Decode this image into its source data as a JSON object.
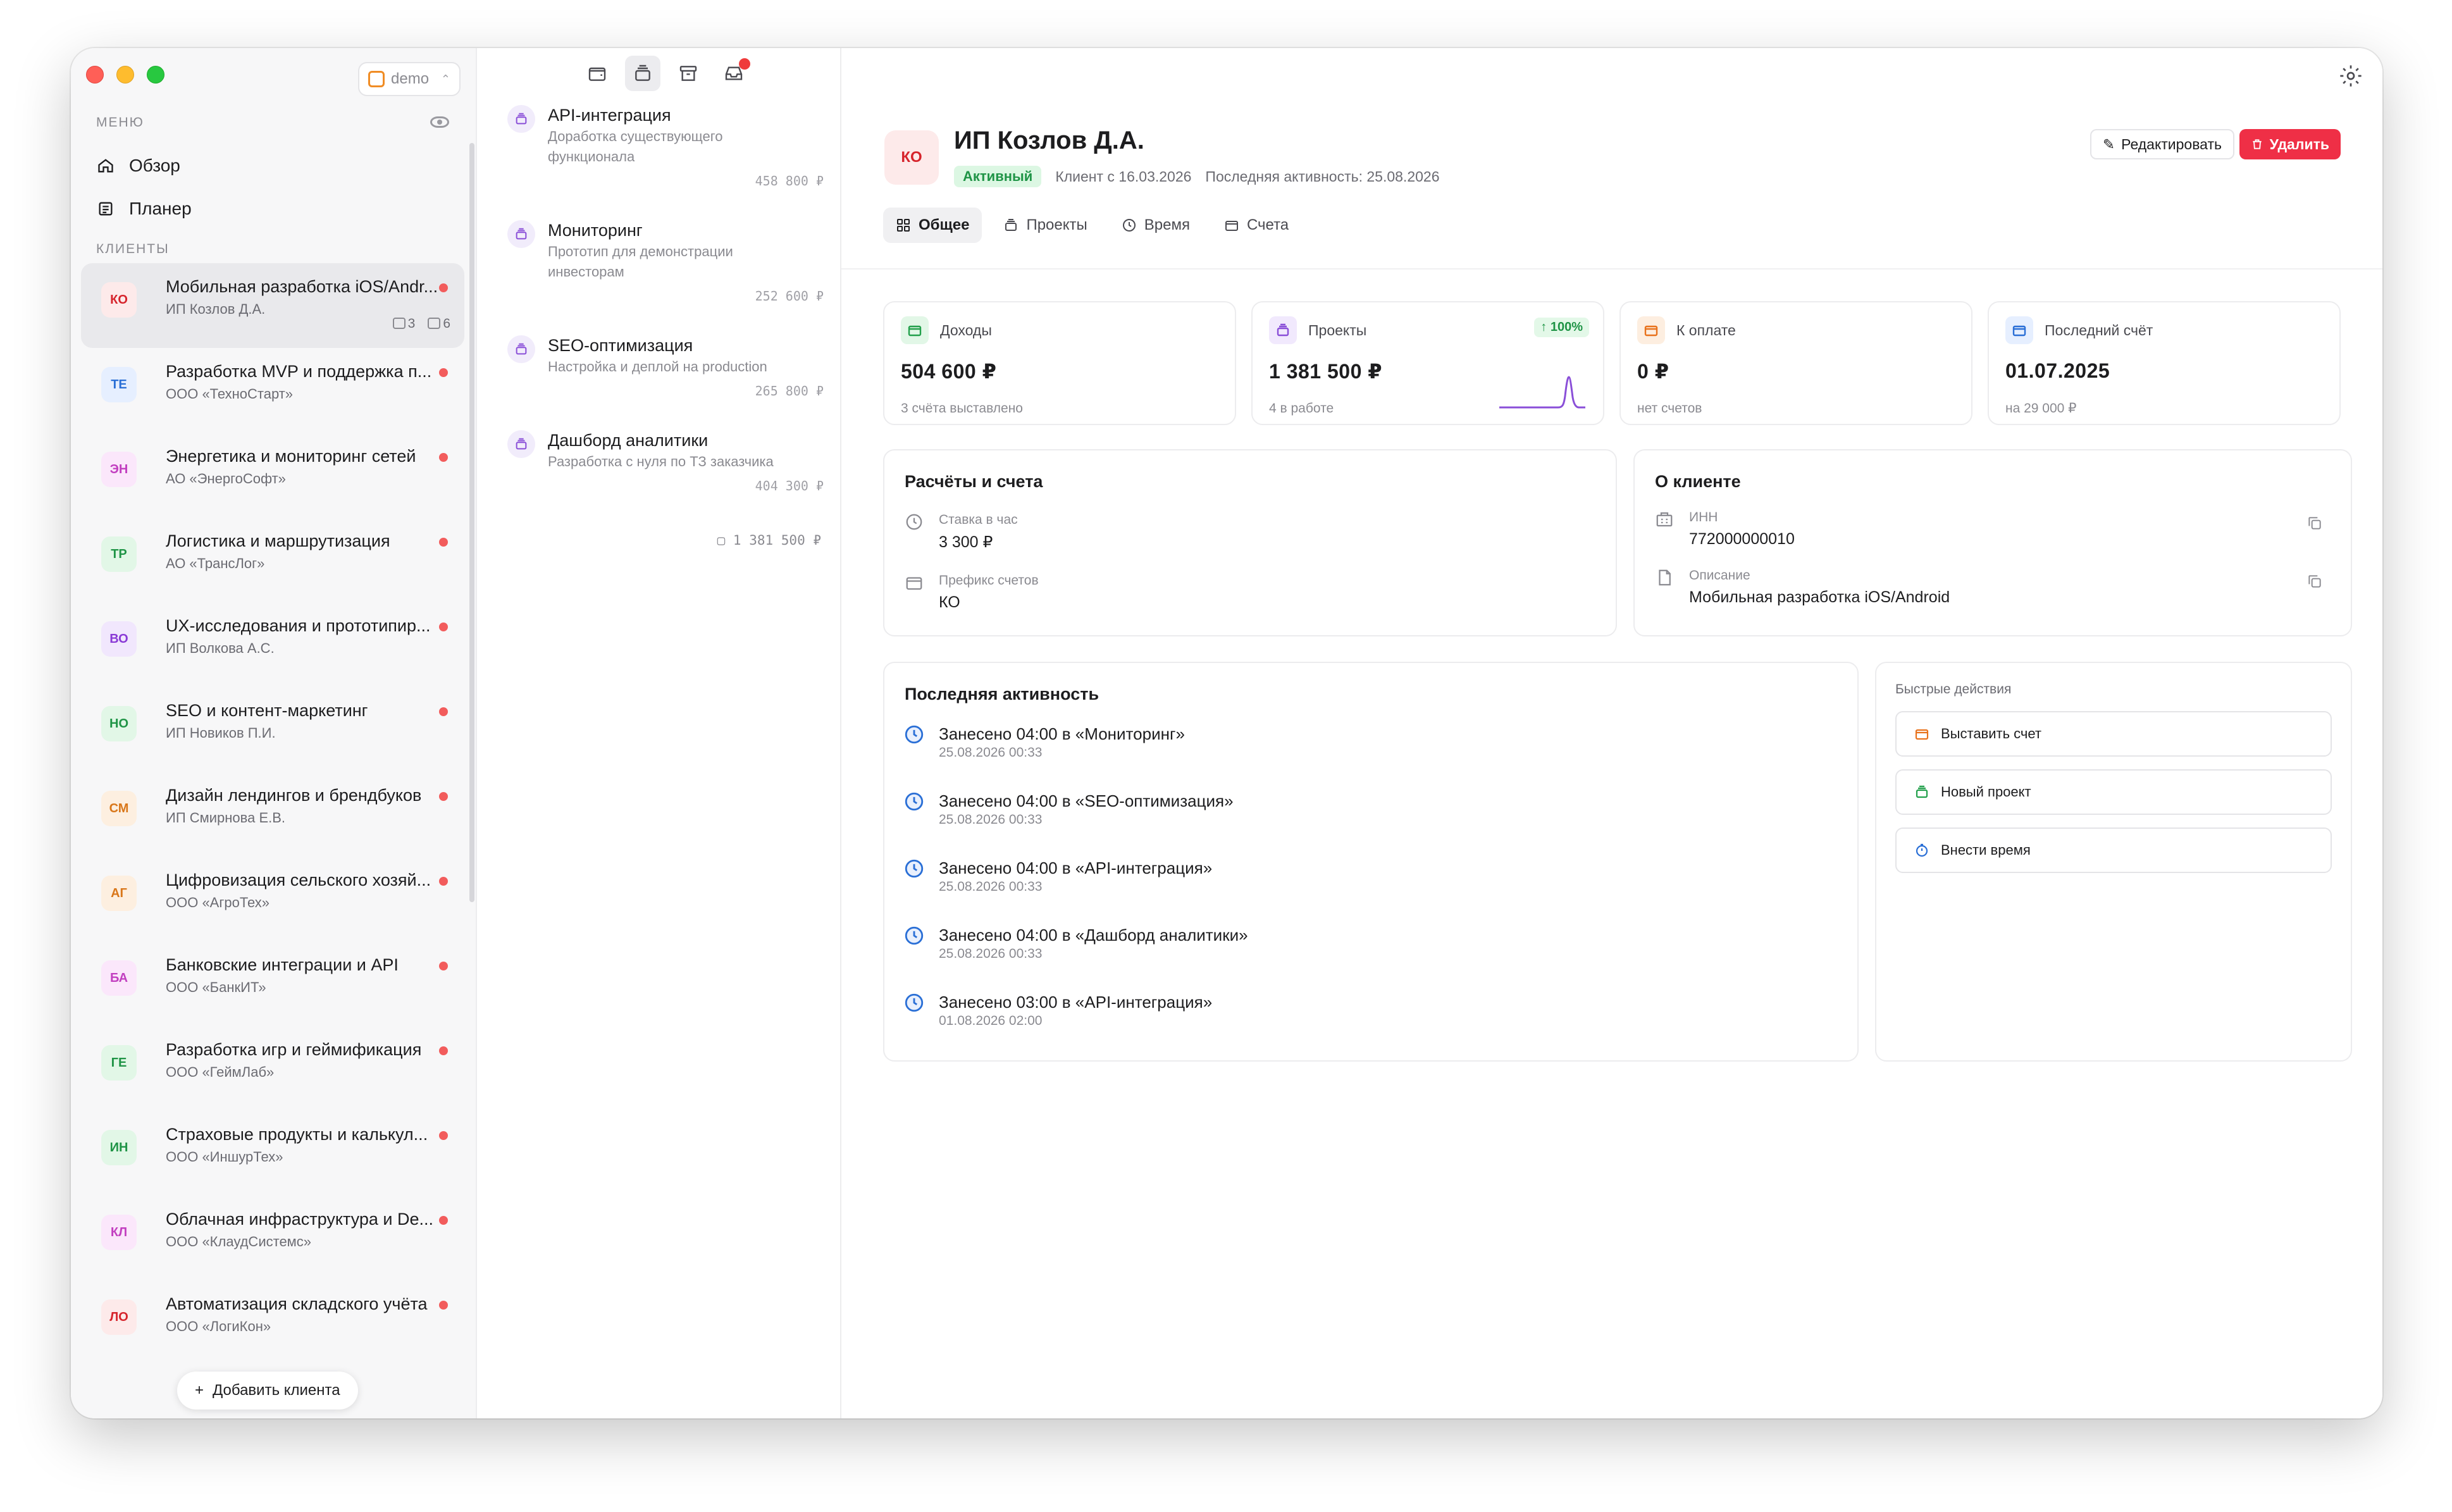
{
  "workspace": {
    "name": "demo"
  },
  "sidebar": {
    "menu_label": "МЕНЮ",
    "nav": [
      {
        "label": "Обзор",
        "icon": "home-icon"
      },
      {
        "label": "Планер",
        "icon": "planner-icon"
      }
    ],
    "clients_label": "КЛИЕНТЫ",
    "clients": [
      {
        "abbr": "КО",
        "name": "Мобильная разработка iOS/Andr...",
        "org": "ИП Козлов Д.А.",
        "invoices": "3",
        "projects": "6",
        "color": "#d6242c",
        "bg": "#fdeaea"
      },
      {
        "abbr": "ТЕ",
        "name": "Разработка MVP и поддержка п...",
        "org": "ООО «ТехноСтарт»",
        "color": "#2a6fd6",
        "bg": "#e6efff"
      },
      {
        "abbr": "ЭН",
        "name": "Энергетика и мониторинг сетей",
        "org": "АО «ЭнергоСофт»",
        "color": "#c23fc0",
        "bg": "#fbe7fb"
      },
      {
        "abbr": "ТР",
        "name": "Логистика и маршрутизация",
        "org": "АО «ТрансЛог»",
        "color": "#1f9446",
        "bg": "#e2f7e7"
      },
      {
        "abbr": "ВО",
        "name": "UX-исследования и прототипир...",
        "org": "ИП Волкова А.С.",
        "color": "#8a3ad6",
        "bg": "#f1e7fd"
      },
      {
        "abbr": "НО",
        "name": "SEO и контент-маркетинг",
        "org": "ИП Новиков П.И.",
        "color": "#1f9446",
        "bg": "#e2f7e7"
      },
      {
        "abbr": "СМ",
        "name": "Дизайн лендингов и брендбуков",
        "org": "ИП Смирнова Е.В.",
        "color": "#d9771a",
        "bg": "#fdefe0"
      },
      {
        "abbr": "АГ",
        "name": "Цифровизация сельского хозяй...",
        "org": "ООО «АгроТех»",
        "color": "#d9771a",
        "bg": "#fdefe0"
      },
      {
        "abbr": "БА",
        "name": "Банковские интеграции и API",
        "org": "ООО «БанкИТ»",
        "color": "#c23fc0",
        "bg": "#fbe7fb"
      },
      {
        "abbr": "ГЕ",
        "name": "Разработка игр и геймификация",
        "org": "ООО «ГеймЛаб»",
        "color": "#1f9446",
        "bg": "#e2f7e7"
      },
      {
        "abbr": "ИН",
        "name": "Страховые продукты и калькул...",
        "org": "ООО «ИншурТех»",
        "color": "#1f9446",
        "bg": "#e2f7e7"
      },
      {
        "abbr": "КЛ",
        "name": "Облачная инфраструктура и De...",
        "org": "ООО «КлаудСистемс»",
        "color": "#c23fc0",
        "bg": "#fbe7fb"
      },
      {
        "abbr": "ЛО",
        "name": "Автоматизация складского учёта",
        "org": "ООО «ЛогиКон»",
        "color": "#d6242c",
        "bg": "#fdeaea"
      }
    ],
    "add_client": "Добавить клиента"
  },
  "projects": {
    "items": [
      {
        "title": "API-интеграция",
        "desc": "Доработка существующего функционала",
        "sum": "458 800 ₽"
      },
      {
        "title": "Мониторинг",
        "desc": "Прототип для демонстрации инвесторам",
        "sum": "252 600 ₽"
      },
      {
        "title": "SEO-оптимизация",
        "desc": "Настройка и деплой на production",
        "sum": "265 800 ₽"
      },
      {
        "title": "Дашборд аналитики",
        "desc": "Разработка с нуля по ТЗ заказчика",
        "sum": "404 300 ₽"
      }
    ],
    "total": "1 381 500 ₽"
  },
  "client": {
    "abbr": "КО",
    "title": "ИП Козлов Д.А.",
    "status": "Активный",
    "since": "Клиент с 16.03.2026",
    "last_activity": "Последняя активность: 25.08.2026",
    "edit": "Редактировать",
    "delete": "Удалить"
  },
  "tabs": [
    {
      "label": "Общее",
      "icon": "grid-icon"
    },
    {
      "label": "Проекты",
      "icon": "briefcase-icon"
    },
    {
      "label": "Время",
      "icon": "clock-icon"
    },
    {
      "label": "Счета",
      "icon": "invoice-icon"
    }
  ],
  "stats": [
    {
      "label": "Доходы",
      "value": "504 600 ₽",
      "sub": "3 счёта выставлено",
      "color": "#22a04b",
      "bg": "#e2f7e7",
      "icon": "wallet-icon"
    },
    {
      "label": "Проекты",
      "value": "1 381 500 ₽",
      "sub": "4 в работе",
      "trend": "↑ 100%",
      "color": "#8a4fd8",
      "bg": "#f1e9fd",
      "icon": "briefcase-icon"
    },
    {
      "label": "К оплате",
      "value": "0 ₽",
      "sub": "нет счетов",
      "color": "#e8721c",
      "bg": "#fdeee0",
      "icon": "wallet-icon"
    },
    {
      "label": "Последний счёт",
      "value": "01.07.2025",
      "sub": "на 29 000 ₽",
      "color": "#2a6fd6",
      "bg": "#e6efff",
      "icon": "invoice-icon"
    }
  ],
  "billing": {
    "title": "Расчёты и счета",
    "rate_label": "Ставка в час",
    "rate_value": "3 300 ₽",
    "prefix_label": "Префикс счетов",
    "prefix_value": "КО"
  },
  "about": {
    "title": "О клиенте",
    "inn_label": "ИНН",
    "inn_value": "772000000010",
    "desc_label": "Описание",
    "desc_value": "Мобильная разработка iOS/Android"
  },
  "activity": {
    "title": "Последняя активность",
    "items": [
      {
        "text": "Занесено 04:00 в «Мониторинг»",
        "date": "25.08.2026 00:33"
      },
      {
        "text": "Занесено 04:00 в «SEO-оптимизация»",
        "date": "25.08.2026 00:33"
      },
      {
        "text": "Занесено 04:00 в «API-интеграция»",
        "date": "25.08.2026 00:33"
      },
      {
        "text": "Занесено 04:00 в «Дашборд аналитики»",
        "date": "25.08.2026 00:33"
      },
      {
        "text": "Занесено 03:00 в «API-интеграция»",
        "date": "01.08.2026 02:00"
      }
    ]
  },
  "quick_actions": {
    "title": "Быстрые действия",
    "items": [
      {
        "label": "Выставить счет",
        "color": "#e8721c",
        "icon": "invoice-icon"
      },
      {
        "label": "Новый проект",
        "color": "#22a04b",
        "icon": "briefcase-icon"
      },
      {
        "label": "Внести время",
        "color": "#2a6fd6",
        "icon": "stopwatch-icon"
      }
    ]
  },
  "colors": {
    "accent_red": "#ef2f46",
    "active_green": "#1f9446"
  }
}
